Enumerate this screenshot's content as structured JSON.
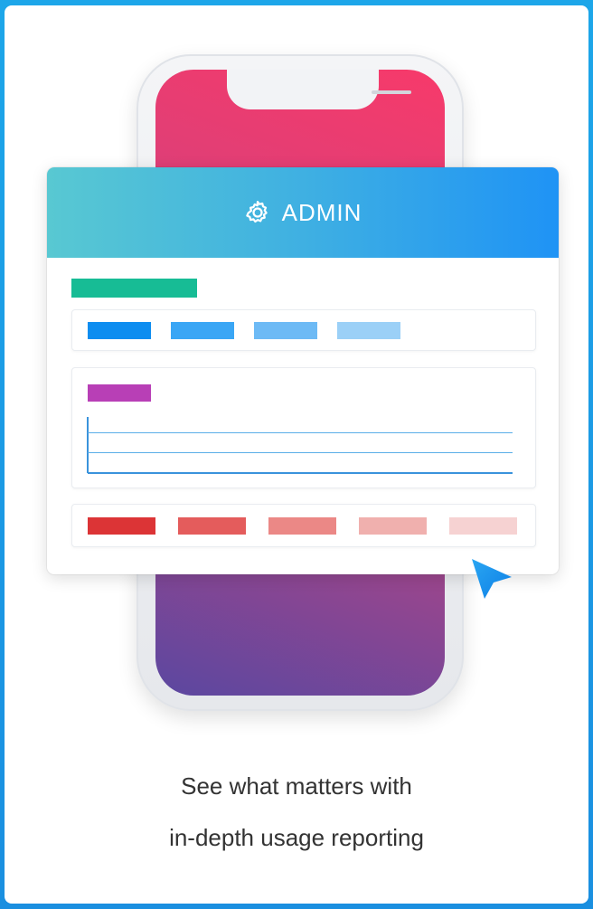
{
  "panel": {
    "title": "ADMIN",
    "icon": "gear-icon"
  },
  "colors": {
    "green_bar": "#17bc95",
    "row1": [
      "#0d8df0",
      "#3aa6f5",
      "#6dbaf5",
      "#9bd0f7"
    ],
    "chart_label": "#b83fb6",
    "row3": [
      "#dc3436",
      "#e45c5c",
      "#eb8886",
      "#f0b0ae",
      "#f6d2d2"
    ]
  },
  "caption": {
    "line1": "See what matters with",
    "line2": "in-depth usage reporting"
  }
}
